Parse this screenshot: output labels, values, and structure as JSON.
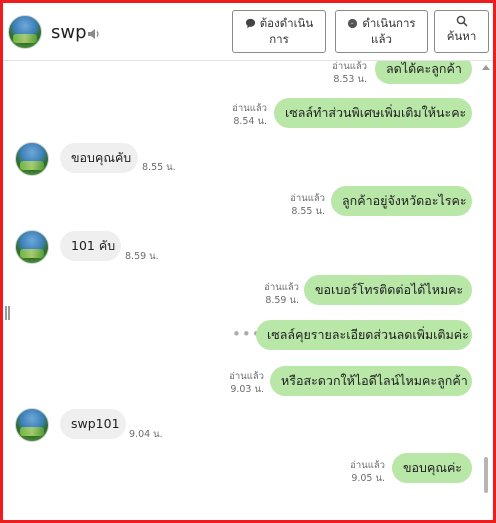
{
  "header": {
    "title": "swp",
    "buttons": [
      {
        "label": "ต้องดำเนิน\nการ",
        "icon": "chat-bubble-icon"
      },
      {
        "label": "ดำเนินการ\nแล้ว",
        "icon": "messenger-icon"
      },
      {
        "label": "ค้นหา",
        "icon": "search-icon"
      }
    ]
  },
  "messages": [
    {
      "dir": "out",
      "text": "ลดได้คะลูกค้า",
      "read": "อ่านแล้ว",
      "time": "8.53 น."
    },
    {
      "dir": "out",
      "text": "เซลล์ทำส่วนพิเศษเพิ่มเติมให้นะคะ",
      "read": "อ่านแล้ว",
      "time": "8.54 น."
    },
    {
      "dir": "in",
      "text": "ขอบคุณคับ",
      "time": "8.55 น."
    },
    {
      "dir": "out",
      "text": "ลูกค้าอยู่จังหวัดอะไรคะ",
      "read": "อ่านแล้ว",
      "time": "8.55 น."
    },
    {
      "dir": "in",
      "text": "101 คับ",
      "time": "8.59 น."
    },
    {
      "dir": "out",
      "text": "ขอเบอร์โทรติดต่อได้ไหมคะ",
      "read": "อ่านแล้ว",
      "time": "8.59 น."
    },
    {
      "dir": "out",
      "text": "เซลล์คุยรายละเอียดส่วนลดเพิ่มเติมค่ะ"
    },
    {
      "dir": "out",
      "text": "หรือสะดวกให้ไอดีไลน์ไหมคะลูกค้า",
      "read": "อ่านแล้ว",
      "time": "9.03 น."
    },
    {
      "dir": "in",
      "text": "swp101",
      "time": "9.04 น."
    },
    {
      "dir": "out",
      "text": "ขอบคุณค่ะ",
      "read": "อ่านแล้ว",
      "time": "9.05 น."
    }
  ],
  "colors": {
    "outgoing_bubble": "#b8e7a8",
    "incoming_bubble": "#efefef",
    "frame_border": "#ee1c1c"
  }
}
